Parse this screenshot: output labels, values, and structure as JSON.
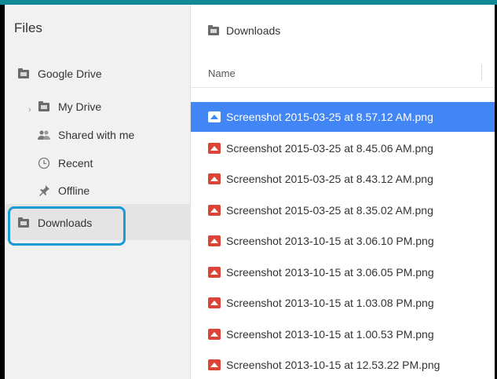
{
  "sidebar": {
    "title": "Files",
    "items": [
      {
        "label": "Google Drive",
        "icon": "drive-folder-icon"
      },
      {
        "label": "My Drive",
        "icon": "folder-icon"
      },
      {
        "label": "Shared with me",
        "icon": "shared-people-icon"
      },
      {
        "label": "Recent",
        "icon": "clock-icon"
      },
      {
        "label": "Offline",
        "icon": "pin-icon"
      },
      {
        "label": "Downloads",
        "icon": "folder-icon"
      }
    ]
  },
  "main": {
    "breadcrumb": "Downloads",
    "column_header": "Name",
    "files": [
      "Screenshot 2015-03-25 at 8.57.12 AM.png",
      "Screenshot 2015-03-25 at 8.45.06 AM.png",
      "Screenshot 2015-03-25 at 8.43.12 AM.png",
      "Screenshot 2015-03-25 at 8.35.02 AM.png",
      "Screenshot 2013-10-15 at 3.06.10 PM.png",
      "Screenshot 2013-10-15 at 3.06.05 PM.png",
      "Screenshot 2013-10-15 at 1.03.08 PM.png",
      "Screenshot 2013-10-15 at 1.00.53 PM.png",
      "Screenshot 2013-10-15 at 12.53.22 PM.png"
    ],
    "selected_index": 0
  },
  "colors": {
    "accent": "#0d8a93",
    "selection": "#4285f4",
    "highlight": "#1c9ad6",
    "file_icon": "#db4437"
  }
}
